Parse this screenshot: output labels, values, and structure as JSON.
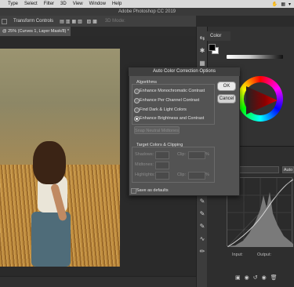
{
  "menubar": {
    "items": [
      "Type",
      "Select",
      "Filter",
      "3D",
      "View",
      "Window",
      "Help"
    ],
    "right_icons": [
      "hand-tool-icon",
      "grid-icon",
      "dropdown-icon"
    ]
  },
  "titlebar": {
    "title": "Adobe Photoshop CC 2019"
  },
  "optionsbar": {
    "label": "Transform Controls",
    "mode": "3D Mode:"
  },
  "document": {
    "tab": "@ 25% (Curves 1, Layer Mask/8) *"
  },
  "panels": {
    "color_tab": "Color",
    "curves": {
      "auto": "Auto",
      "input": "Input:",
      "output": "Output:"
    }
  },
  "dialog": {
    "title": "Auto Color Correction Options",
    "ok": "OK",
    "cancel": "Cancel",
    "algorithms_label": "Algorithms",
    "algorithms": [
      "Enhance Monochromatic Contrast",
      "Enhance Per Channel Contrast",
      "Find Dark & Light Colors",
      "Enhance Brightness and Contrast"
    ],
    "selected_algorithm": "Enhance Brightness and Contrast",
    "snap_label": "Snap Neutral Midtones",
    "target_label": "Target Colors & Clipping",
    "targets": [
      {
        "label": "Shadows:",
        "clip": "Clip:",
        "pct": "%"
      },
      {
        "label": "Midtones:"
      },
      {
        "label": "Highlights:",
        "clip": "Clip:",
        "pct": "%"
      }
    ],
    "save_default": "Save as defaults"
  },
  "colors": {
    "accent_red": "#e00000",
    "dialog_bg": "#535353"
  }
}
